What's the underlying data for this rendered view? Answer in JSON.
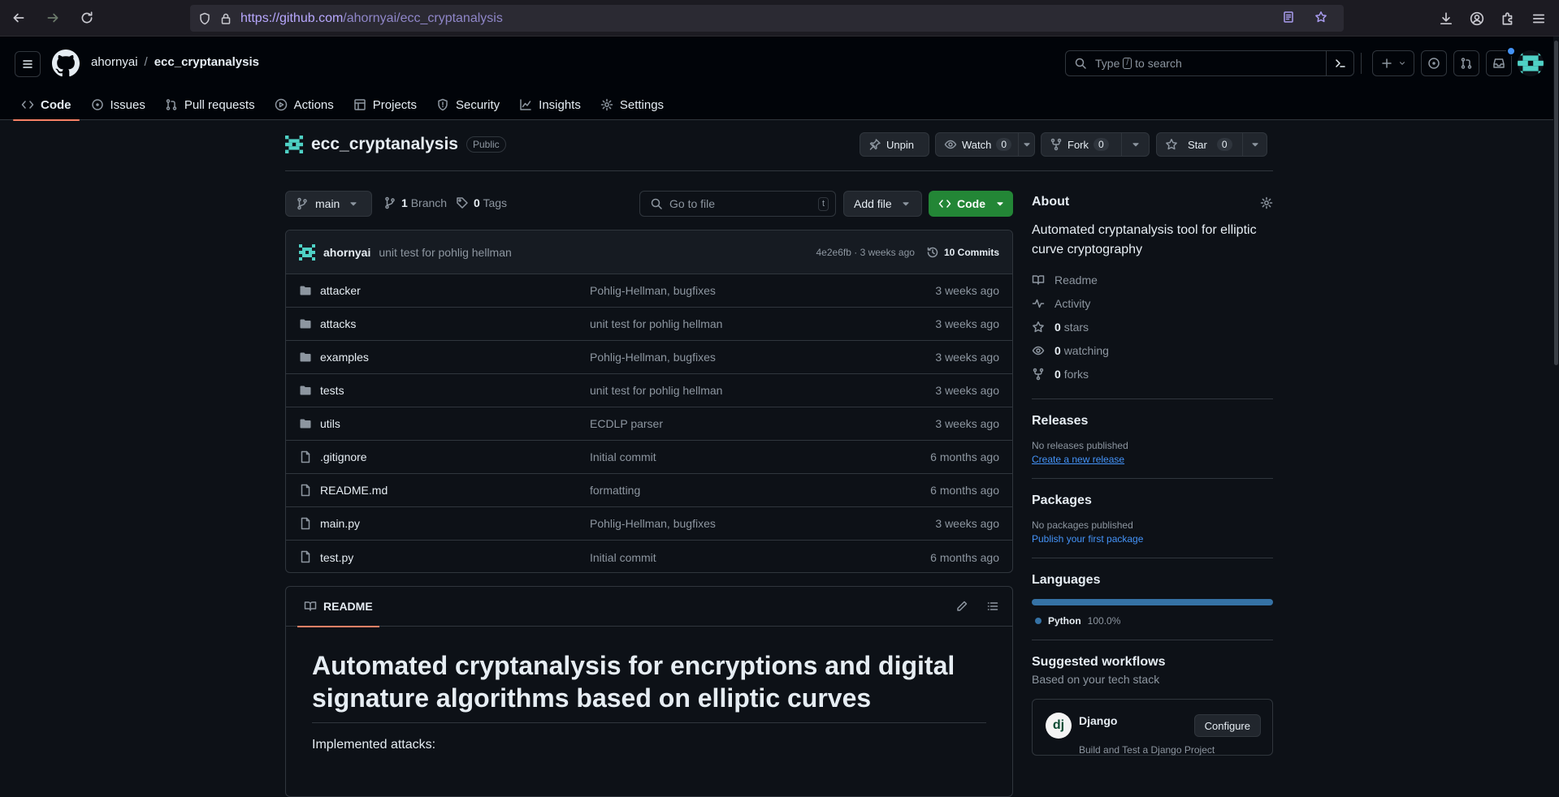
{
  "browser": {
    "url_host": "https://github.com",
    "url_path": "/ahornyai/ecc_cryptanalysis"
  },
  "header": {
    "owner": "ahornyai",
    "separator": "/",
    "repo": "ecc_cryptanalysis",
    "search_prefix": "Type",
    "search_slash": "/",
    "search_suffix": "to search"
  },
  "tabs": [
    {
      "label": "Code",
      "icon": "code-icon"
    },
    {
      "label": "Issues",
      "icon": "issue-icon"
    },
    {
      "label": "Pull requests",
      "icon": "pull-request-icon"
    },
    {
      "label": "Actions",
      "icon": "play-icon"
    },
    {
      "label": "Projects",
      "icon": "table-icon"
    },
    {
      "label": "Security",
      "icon": "shield-icon"
    },
    {
      "label": "Insights",
      "icon": "graph-icon"
    },
    {
      "label": "Settings",
      "icon": "gear-icon"
    }
  ],
  "repo": {
    "name": "ecc_cryptanalysis",
    "visibility": "Public",
    "unpin": "Unpin",
    "watch": "Watch",
    "watch_count": "0",
    "fork": "Fork",
    "fork_count": "0",
    "star": "Star",
    "star_count": "0"
  },
  "branchbar": {
    "branch": "main",
    "branch_count": "1",
    "branch_label": "Branch",
    "tag_count": "0",
    "tag_label": "Tags",
    "goto_placeholder": "Go to file",
    "goto_key": "t",
    "add_file": "Add file",
    "code": "Code"
  },
  "commit": {
    "author": "ahornyai",
    "message": "unit test for pohlig hellman",
    "hash": "4e2e6fb",
    "dot": "·",
    "time": "3 weeks ago",
    "commits_label": "10 Commits"
  },
  "files": [
    {
      "name": "attacker",
      "type": "dir",
      "message": "Pohlig-Hellman, bugfixes",
      "date": "3 weeks ago"
    },
    {
      "name": "attacks",
      "type": "dir",
      "message": "unit test for pohlig hellman",
      "date": "3 weeks ago"
    },
    {
      "name": "examples",
      "type": "dir",
      "message": "Pohlig-Hellman, bugfixes",
      "date": "3 weeks ago"
    },
    {
      "name": "tests",
      "type": "dir",
      "message": "unit test for pohlig hellman",
      "date": "3 weeks ago"
    },
    {
      "name": "utils",
      "type": "dir",
      "message": "ECDLP parser",
      "date": "3 weeks ago"
    },
    {
      "name": ".gitignore",
      "type": "file",
      "message": "Initial commit",
      "date": "6 months ago"
    },
    {
      "name": "README.md",
      "type": "file",
      "message": "formatting",
      "date": "6 months ago"
    },
    {
      "name": "main.py",
      "type": "file",
      "message": "Pohlig-Hellman, bugfixes",
      "date": "3 weeks ago"
    },
    {
      "name": "test.py",
      "type": "file",
      "message": "Initial commit",
      "date": "6 months ago"
    }
  ],
  "readme": {
    "tab": "README",
    "heading": "Automated cryptanalysis for encryptions and digital signature algorithms based on elliptic curves",
    "intro": "Implemented attacks:"
  },
  "about": {
    "title": "About",
    "description": "Automated cryptanalysis tool for elliptic curve cryptography",
    "readme": "Readme",
    "activity": "Activity",
    "stars_count": "0",
    "stars_label": "stars",
    "watching_count": "0",
    "watching_label": "watching",
    "forks_count": "0",
    "forks_label": "forks"
  },
  "releases": {
    "title": "Releases",
    "none": "No releases published",
    "create": "Create a new release"
  },
  "packages": {
    "title": "Packages",
    "none": "No packages published",
    "publish": "Publish your first package"
  },
  "languages": {
    "title": "Languages",
    "items": [
      {
        "name": "Python",
        "percent": "100.0%",
        "fraction": 1.0,
        "color": "#3572A5"
      }
    ]
  },
  "workflows": {
    "title": "Suggested workflows",
    "subtitle": "Based on your tech stack",
    "card_logo": "dj",
    "card_name": "Django",
    "card_desc": "Build and Test a Django Project",
    "configure": "Configure"
  },
  "colors": {
    "accent_green": "#238636",
    "link_blue": "#4493f8",
    "tab_underline": "#f78166"
  }
}
